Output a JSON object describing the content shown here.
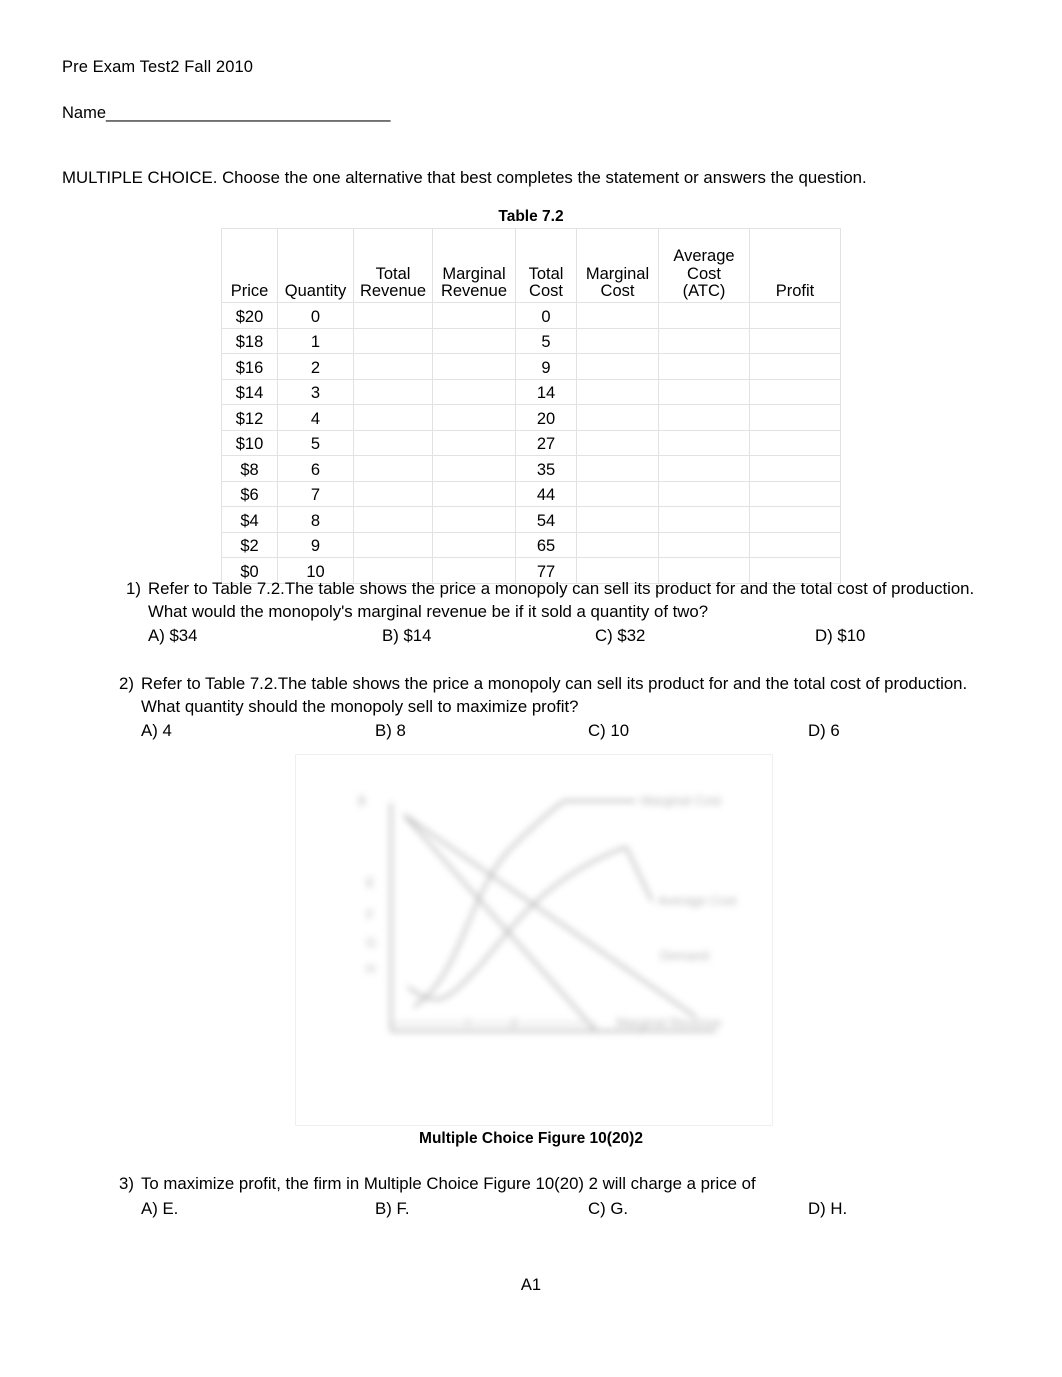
{
  "header": {
    "doc_title": "Pre Exam Test2 Fall 2010",
    "name_label": "Name_______________________________",
    "instruction": "MULTIPLE CHOICE.  Choose the one alternative that best completes the statement or answers the question."
  },
  "table": {
    "caption": "Table 7.2",
    "columns": [
      {
        "line1": "Price",
        "line2": ""
      },
      {
        "line1": "Quantity",
        "line2": ""
      },
      {
        "line1": "Total",
        "line2": "Revenue"
      },
      {
        "line1": "Marginal",
        "line2": "Revenue"
      },
      {
        "line1": "Total",
        "line2": "Cost"
      },
      {
        "line1": "Marginal",
        "line2": "Cost"
      },
      {
        "line1": "Average",
        "line2": "Cost",
        "line3": "(ATC)"
      },
      {
        "line1": "Profit",
        "line2": ""
      }
    ],
    "rows": [
      {
        "price": "$20",
        "quantity": "0",
        "total_revenue": "",
        "marginal_revenue": "",
        "total_cost": "0",
        "marginal_cost": "",
        "atc": "",
        "profit": ""
      },
      {
        "price": "$18",
        "quantity": "1",
        "total_revenue": "",
        "marginal_revenue": "",
        "total_cost": "5",
        "marginal_cost": "",
        "atc": "",
        "profit": ""
      },
      {
        "price": "$16",
        "quantity": "2",
        "total_revenue": "",
        "marginal_revenue": "",
        "total_cost": "9",
        "marginal_cost": "",
        "atc": "",
        "profit": ""
      },
      {
        "price": "$14",
        "quantity": "3",
        "total_revenue": "",
        "marginal_revenue": "",
        "total_cost": "14",
        "marginal_cost": "",
        "atc": "",
        "profit": ""
      },
      {
        "price": "$12",
        "quantity": "4",
        "total_revenue": "",
        "marginal_revenue": "",
        "total_cost": "20",
        "marginal_cost": "",
        "atc": "",
        "profit": ""
      },
      {
        "price": "$10",
        "quantity": "5",
        "total_revenue": "",
        "marginal_revenue": "",
        "total_cost": "27",
        "marginal_cost": "",
        "atc": "",
        "profit": ""
      },
      {
        "price": "$8",
        "quantity": "6",
        "total_revenue": "",
        "marginal_revenue": "",
        "total_cost": "35",
        "marginal_cost": "",
        "atc": "",
        "profit": ""
      },
      {
        "price": "$6",
        "quantity": "7",
        "total_revenue": "",
        "marginal_revenue": "",
        "total_cost": "44",
        "marginal_cost": "",
        "atc": "",
        "profit": ""
      },
      {
        "price": "$4",
        "quantity": "8",
        "total_revenue": "",
        "marginal_revenue": "",
        "total_cost": "54",
        "marginal_cost": "",
        "atc": "",
        "profit": ""
      },
      {
        "price": "$2",
        "quantity": "9",
        "total_revenue": "",
        "marginal_revenue": "",
        "total_cost": "65",
        "marginal_cost": "",
        "atc": "",
        "profit": ""
      },
      {
        "price": "$0",
        "quantity": "10",
        "total_revenue": "",
        "marginal_revenue": "",
        "total_cost": "77",
        "marginal_cost": "",
        "atc": "",
        "profit": ""
      }
    ]
  },
  "questions": [
    {
      "number": "1)",
      "line1": "Refer to Table 7.2.The table shows the price a monopoly can sell its product for and the total cost of production.",
      "line2": "What would the monopoly's marginal revenue be if it sold a quantity of two?",
      "options": {
        "a": "A) $34",
        "b": "B) $14",
        "c": "C) $32",
        "d": "D)  $10"
      }
    },
    {
      "number": "2)",
      "line1": "Refer to Table 7.2.The table shows the price a monopoly can sell its product for and the total cost of production.",
      "line2": "What quantity should the monopoly sell to maximize profit?",
      "options": {
        "a": "A) 4",
        "b": "B) 8",
        "c": "C) 10",
        "d": "D)  6"
      }
    },
    {
      "number": "3)",
      "line1": "To maximize profit, the firm in Multiple Choice Figure 10(20) 2 will charge a price of",
      "line2": "",
      "options": {
        "a": "A) E.",
        "b": "B) F.",
        "c": "C) G.",
        "d": "D)  H."
      }
    }
  ],
  "figure": {
    "caption": "Multiple Choice Figure 10(20)2",
    "axis_y_label": "$",
    "curve_labels": [
      "Marginal Cost",
      "Average Cost",
      "Demand",
      "Marginal Revenue"
    ],
    "price_markers": [
      "E",
      "F",
      "G",
      "H"
    ],
    "quantity_markers": [
      "I",
      "J"
    ]
  },
  "footer": {
    "page_label": "A1"
  },
  "colors": {
    "text": "#000000",
    "table_grid": "#e2e2e2",
    "figure_border": "#f0f0f0"
  }
}
